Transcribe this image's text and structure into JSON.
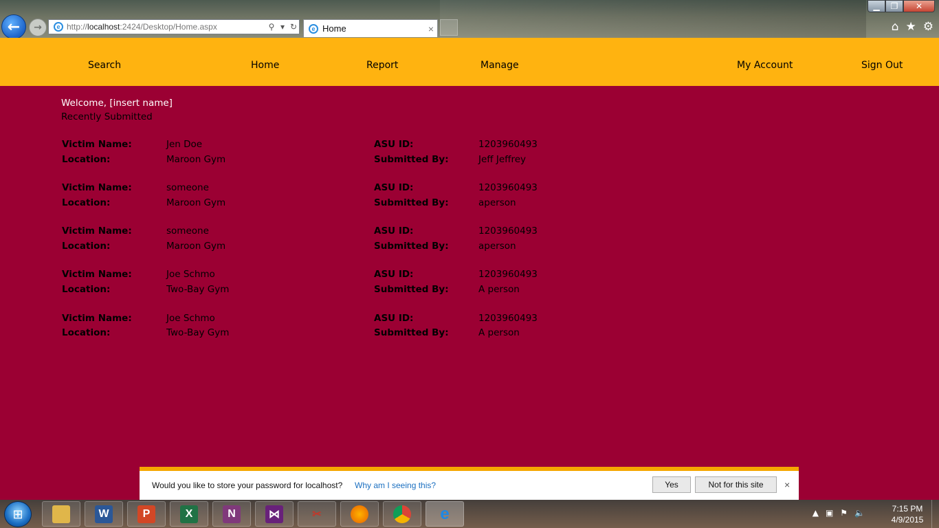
{
  "browser": {
    "url_prefix": "http://",
    "url_host": "localhost",
    "url_rest": ":2424/Desktop/Home.aspx",
    "tab_title": "Home",
    "tab_close": "×",
    "window_buttons": {
      "minimize": "▁",
      "maximize": "❐",
      "close": "✕"
    },
    "toolbar_icons": [
      "home-icon",
      "favorites-star-icon",
      "gear-icon"
    ]
  },
  "nav": {
    "search": "Search",
    "home": "Home",
    "report": "Report",
    "manage": "Manage",
    "account": "My Account",
    "signout": "Sign Out"
  },
  "content": {
    "welcome": "Welcome, [insert name]",
    "recent_heading": "Recently Submitted",
    "labels": {
      "victim": "Victim Name:",
      "location": "Location:",
      "asu": "ASU ID:",
      "submitted": "Submitted By:"
    },
    "records": [
      {
        "victim": "Jen Doe",
        "location": "Maroon Gym",
        "asu_id": "1203960493",
        "submitted_by": "Jeff Jeffrey"
      },
      {
        "victim": "someone",
        "location": "Maroon Gym",
        "asu_id": "1203960493",
        "submitted_by": "aperson"
      },
      {
        "victim": "someone",
        "location": "Maroon Gym",
        "asu_id": "1203960493",
        "submitted_by": "aperson"
      },
      {
        "victim": "Joe Schmo",
        "location": "Two-Bay Gym",
        "asu_id": "1203960493",
        "submitted_by": "A person"
      },
      {
        "victim": "Joe Schmo",
        "location": "Two-Bay Gym",
        "asu_id": "1203960493",
        "submitted_by": "A person"
      }
    ]
  },
  "password_bar": {
    "question": "Would you like to store your password for localhost?",
    "why": "Why am I seeing this?",
    "yes": "Yes",
    "not_for_site": "Not for this site",
    "close": "×"
  },
  "taskbar": {
    "apps": [
      {
        "name": "file-explorer",
        "color": "#e0b64a"
      },
      {
        "name": "word",
        "glyph": "W",
        "color": "#2b5797"
      },
      {
        "name": "powerpoint",
        "glyph": "P",
        "color": "#d24726"
      },
      {
        "name": "excel",
        "glyph": "X",
        "color": "#207245"
      },
      {
        "name": "onenote",
        "glyph": "N",
        "color": "#80397b"
      },
      {
        "name": "visual-studio",
        "color": "#68217a"
      },
      {
        "name": "snipping-tool",
        "color": "#c9d1d9"
      },
      {
        "name": "firefox",
        "color": "#e66000"
      },
      {
        "name": "chrome",
        "color": "#4caf50"
      },
      {
        "name": "internet-explorer",
        "glyph": "e",
        "color": "#1e88e5"
      }
    ],
    "time": "7:15 PM",
    "date": "4/9/2015"
  },
  "colors": {
    "page_background": "#9b0033",
    "nav_background": "#ffb310",
    "welcome_text": "#ffffff",
    "password_bar_accent": "#f5a600"
  }
}
